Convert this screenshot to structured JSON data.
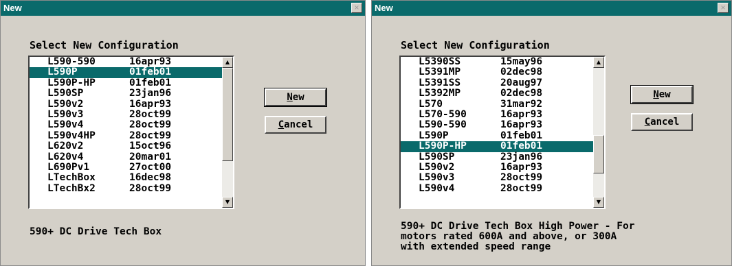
{
  "left_dialog": {
    "title": "New",
    "close_glyph": "×",
    "prompt": "Select New Configuration",
    "items": [
      {
        "name": "L590-590",
        "date": "16apr93"
      },
      {
        "name": "L590P",
        "date": "01feb01",
        "selected": true
      },
      {
        "name": "L590P-HP",
        "date": "01feb01"
      },
      {
        "name": "L590SP",
        "date": "23jan96"
      },
      {
        "name": "L590v2",
        "date": "16apr93"
      },
      {
        "name": "L590v3",
        "date": "28oct99"
      },
      {
        "name": "L590v4",
        "date": "28oct99"
      },
      {
        "name": "L590v4HP",
        "date": "28oct99"
      },
      {
        "name": "L620v2",
        "date": "15oct96"
      },
      {
        "name": "L620v4",
        "date": "20mar01"
      },
      {
        "name": "L690Pv1",
        "date": "27oct00"
      },
      {
        "name": "LTechBox",
        "date": "16dec98"
      },
      {
        "name": "LTechBx2",
        "date": "28oct99"
      }
    ],
    "new_button": "New",
    "cancel_button": "Cancel",
    "description": "590+ DC Drive Tech Box"
  },
  "right_dialog": {
    "title": "New",
    "close_glyph": "×",
    "prompt": "Select New Configuration",
    "items": [
      {
        "name": "L5390SS",
        "date": "15may96"
      },
      {
        "name": "L5391MP",
        "date": "02dec98"
      },
      {
        "name": "L5391SS",
        "date": "20aug97"
      },
      {
        "name": "L5392MP",
        "date": "02dec98"
      },
      {
        "name": "L570",
        "date": "31mar92"
      },
      {
        "name": "L570-590",
        "date": "16apr93"
      },
      {
        "name": "L590-590",
        "date": "16apr93"
      },
      {
        "name": "L590P",
        "date": "01feb01"
      },
      {
        "name": "L590P-HP",
        "date": "01feb01",
        "selected": true
      },
      {
        "name": "L590SP",
        "date": "23jan96"
      },
      {
        "name": "L590v2",
        "date": "16apr93"
      },
      {
        "name": "L590v3",
        "date": "28oct99"
      },
      {
        "name": "L590v4",
        "date": "28oct99"
      }
    ],
    "new_button": "New",
    "cancel_button": "Cancel",
    "description": "590+ DC Drive Tech Box High Power - For\nmotors rated 600A and above, or 300A\nwith extended speed range"
  },
  "icons": {
    "scroll_up": "▲",
    "scroll_down": "▼"
  },
  "colors": {
    "titlebar": "#0a6a6b",
    "selection": "#0a6a6b",
    "dialog_bg": "#d4d0c8"
  }
}
